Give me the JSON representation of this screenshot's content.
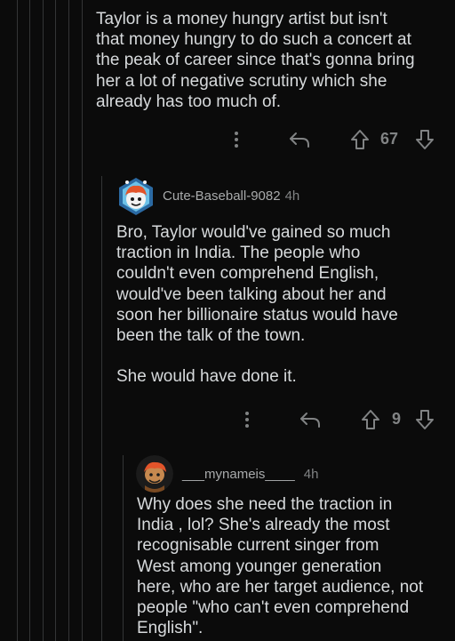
{
  "comments": [
    {
      "body_lines": [
        "Taylor is a money hungry artist but isn't",
        "that money hungry to do such a concert at",
        "the peak of career since that's gonna bring",
        "her a lot of negative scrutiny which she",
        "already has too much of."
      ],
      "score": "67",
      "actions": {
        "more_icon": "vertical-dots-icon",
        "reply_icon": "reply-arrow-icon",
        "upvote_icon": "upvote-arrow-icon",
        "downvote_icon": "downvote-arrow-icon"
      }
    },
    {
      "username": "Cute-Baseball-9082",
      "time": "4h",
      "body_lines": [
        "Bro, Taylor would've gained so much",
        "traction in India. The people who",
        "couldn't even comprehend English,",
        "would've been talking about her and",
        "soon her billionaire status would have",
        "been the talk of the town.",
        "",
        "She would have done it."
      ],
      "score": "9"
    },
    {
      "username": "___mynameis____",
      "time": "4h",
      "body_lines": [
        "Why does she need the traction in",
        "India , lol?  She's already the most",
        "recognisable current singer from",
        "West among younger generation",
        "here, who are her target audience, not",
        "people \"who can't even comprehend",
        "English\"."
      ]
    }
  ],
  "colors": {
    "background": "#0b0b0b",
    "text": "#d7dadc",
    "muted": "#818384",
    "thread_line": "#343536"
  }
}
